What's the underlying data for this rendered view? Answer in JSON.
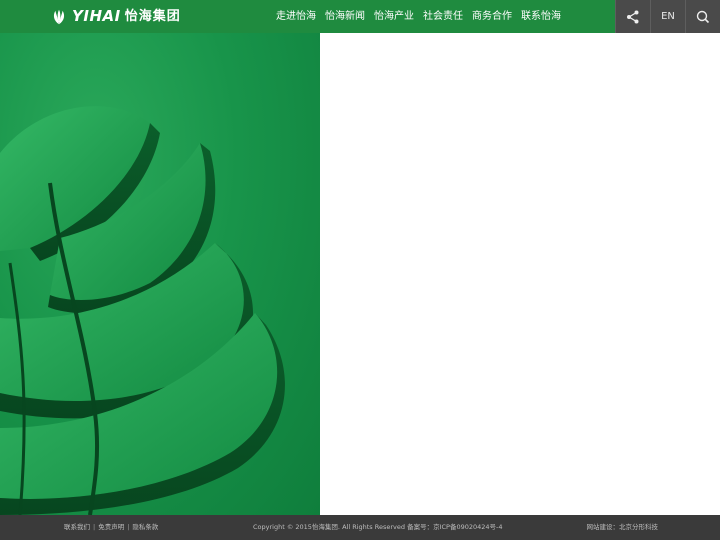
{
  "header": {
    "logo": {
      "latin": "YIHAI",
      "cjk": "怡海集团",
      "icon": "yihai-leaf-logo-icon"
    },
    "nav": [
      "走进怡海",
      "怡海新闻",
      "怡海产业",
      "社会责任",
      "商务合作",
      "联系怡海"
    ],
    "tools": {
      "share_icon": "share-icon",
      "language": "EN",
      "search_icon": "search-icon"
    }
  },
  "footer": {
    "links": [
      "联系我们",
      "免责声明",
      "隐私条款"
    ],
    "separator": "|",
    "copyright": "Copyright © 2015怡海集团. All Rights Reserved  备案号：京ICP备09020424号-4",
    "builder": "网站建设：北京分形科技"
  },
  "colors": {
    "brand_green": "#1f8b3f",
    "tool_bg": "#4a4a4a",
    "footer_bg": "#3a3a3a"
  }
}
